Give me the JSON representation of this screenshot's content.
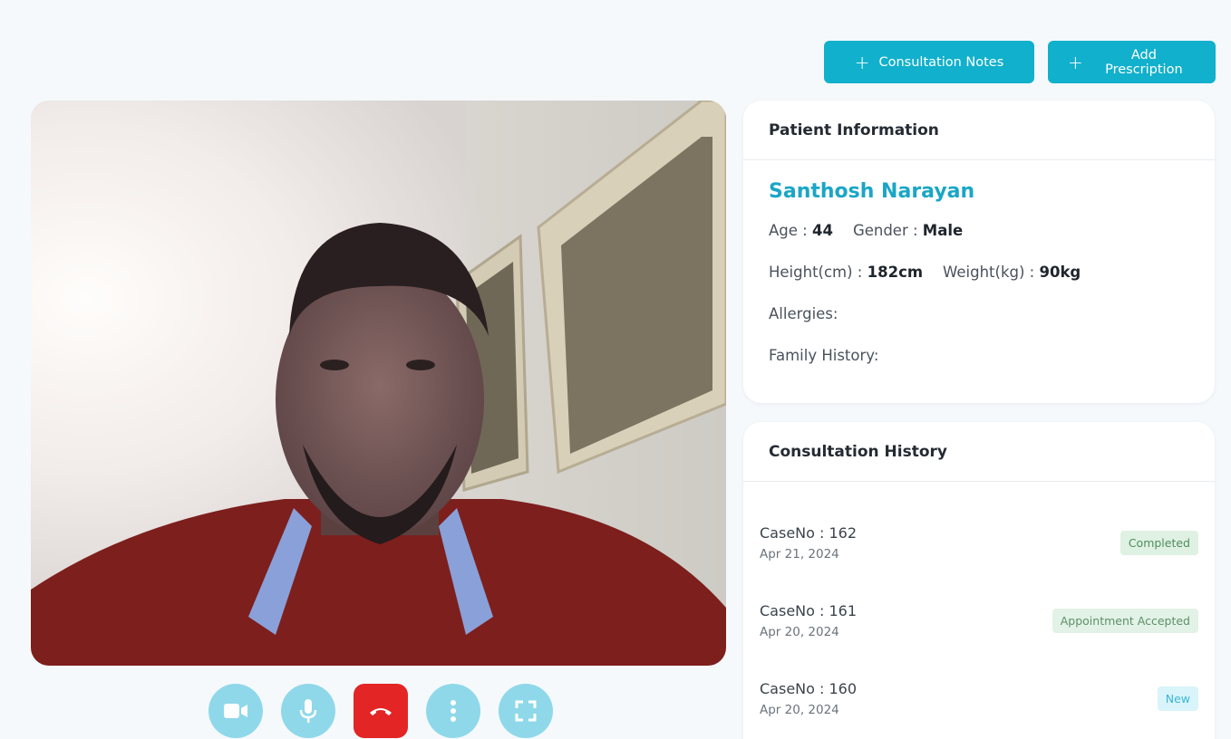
{
  "actions": {
    "consultation_notes_label": "Consultation Notes",
    "add_prescription_label": "Add Prescription",
    "plus_glyph": "+"
  },
  "call_controls": [
    {
      "icon": "video-camera-icon"
    },
    {
      "icon": "microphone-icon"
    },
    {
      "icon": "end-call-icon"
    },
    {
      "icon": "more-options-icon"
    },
    {
      "icon": "fullscreen-icon"
    }
  ],
  "patient": {
    "heading": "Patient Information",
    "name": "Santhosh Narayan",
    "age_label": "Age :",
    "age": "44",
    "gender_label": "Gender :",
    "gender": "Male",
    "height_label": "Height(cm) :",
    "height": "182cm",
    "weight_label": "Weight(kg) :",
    "weight": "90kg",
    "allergies_label": "Allergies:",
    "family_history_label": "Family History:"
  },
  "history": {
    "heading": "Consultation History",
    "items": [
      {
        "case": "CaseNo : 162",
        "date": "Apr 21, 2024",
        "status": "Completed"
      },
      {
        "case": "CaseNo : 161",
        "date": "Apr 20, 2024",
        "status": "Appointment Accepted"
      },
      {
        "case": "CaseNo : 160",
        "date": "Apr 20, 2024",
        "status": "New"
      }
    ]
  },
  "colors": {
    "accent": "#11b0cc",
    "patient_name": "#1aa6c6",
    "control_bg": "#8fd8ea",
    "end_call": "#e32525"
  }
}
